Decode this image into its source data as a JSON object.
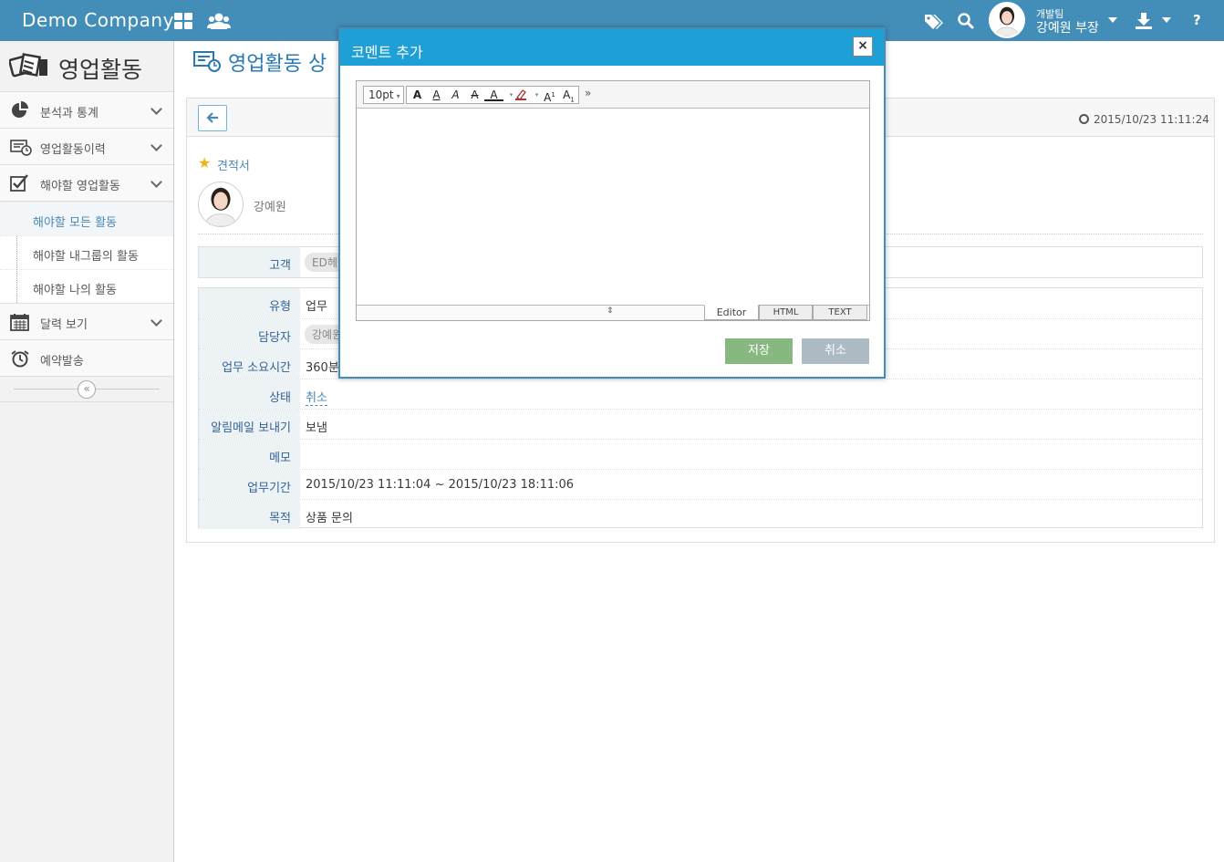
{
  "topbar": {
    "brand": "Demo Company",
    "user_team": "개발팀",
    "user_name": "강예원 부장",
    "help": "?"
  },
  "icons": [
    "apps-grid-icon",
    "users-icon",
    "tags-icon",
    "search-icon",
    "download-icon",
    "help-icon",
    "clock-icon",
    "star-icon",
    "arrow-left-icon"
  ],
  "sidebar": {
    "title": "영업활동",
    "items": [
      {
        "label": "분석과 통계",
        "icon": "pie-chart-icon"
      },
      {
        "label": "영업활동이력",
        "icon": "history-icon"
      },
      {
        "label": "해야할 영업활동",
        "icon": "checkbox-icon"
      }
    ],
    "subitems": [
      {
        "label": "해야할 모든 활동",
        "active": true
      },
      {
        "label": "해야할 내그룹의 활동",
        "active": false
      },
      {
        "label": "해야할 나의 활동",
        "active": false
      }
    ],
    "items_after": [
      {
        "label": "달력 보기",
        "icon": "calendar-icon"
      },
      {
        "label": "예약발송",
        "icon": "alarm-clock-icon"
      }
    ],
    "collapse": "«"
  },
  "main": {
    "page_title": "영업활동 상",
    "timestamp": "2015/10/23 11:11:24",
    "category": "견적서",
    "owner": "강예원",
    "customer": {
      "label": "고객",
      "value": "ED헤"
    },
    "details": [
      {
        "label": "유형",
        "value": "업무"
      },
      {
        "label": "담당자",
        "value": "강예원"
      },
      {
        "label": "업무 소요시간",
        "value": "360분"
      },
      {
        "label": "상태",
        "value": "취소"
      },
      {
        "label": "알림메일 보내기",
        "value": "보냄"
      },
      {
        "label": "메모",
        "value": ""
      },
      {
        "label": "업무기간",
        "value": "2015/10/23 11:11:04 ~ 2015/10/23 18:11:06"
      },
      {
        "label": "목적",
        "value": "상품 문의"
      }
    ]
  },
  "modal": {
    "title": "코멘트 추가",
    "close": "×",
    "font_size": "10pt",
    "toolbar_more": "»",
    "tabs": [
      "Editor",
      "HTML",
      "TEXT"
    ],
    "save": "저장",
    "cancel": "취소"
  },
  "colors": {
    "topbar": "#438eb9",
    "modal_header": "#1e9fd6",
    "save_button": "#87b87f",
    "cancel_button": "#abbac3",
    "label_bg": "#edf3f4"
  }
}
